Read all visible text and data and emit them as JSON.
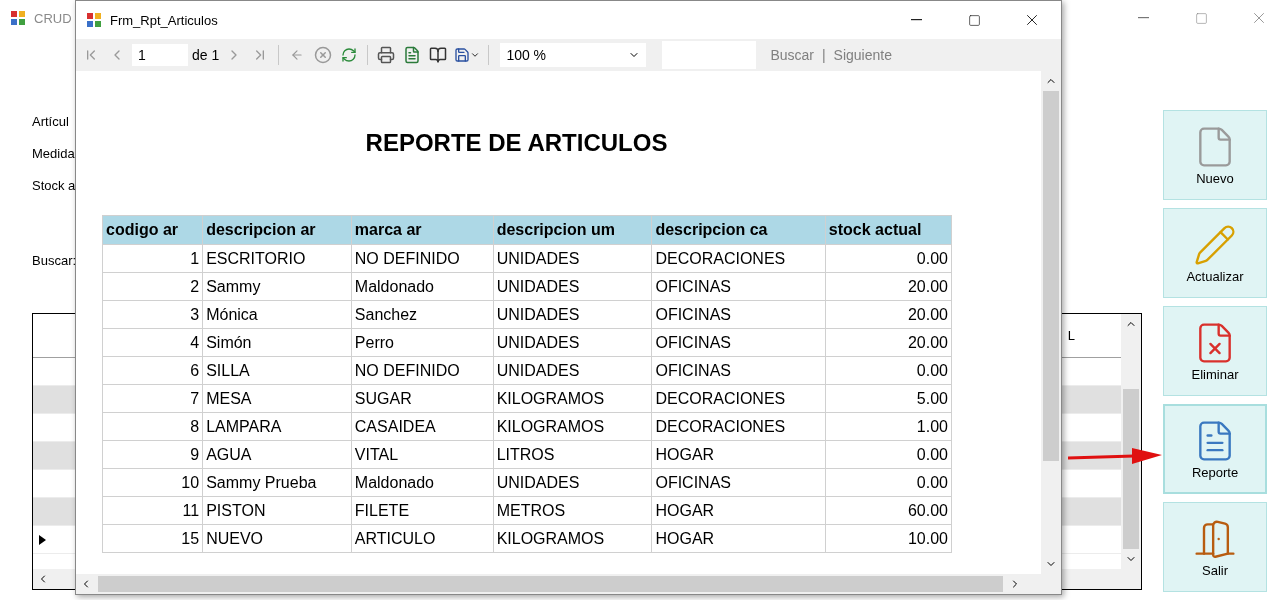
{
  "main_window": {
    "title": "CRUD",
    "labels": [
      "Artícul",
      "Medida",
      "Stock a",
      "Buscar:"
    ],
    "grid": {
      "header_text": "L"
    },
    "buttons": [
      {
        "label": "Nuevo",
        "kind": "new",
        "focused": false
      },
      {
        "label": "Actualizar",
        "kind": "edit",
        "focused": false
      },
      {
        "label": "Eliminar",
        "kind": "delete",
        "focused": false
      },
      {
        "label": "Reporte",
        "kind": "report",
        "focused": true
      },
      {
        "label": "Salir",
        "kind": "exit",
        "focused": false
      }
    ]
  },
  "report_window": {
    "title": "Frm_Rpt_Articulos",
    "toolbar": {
      "page": "1",
      "of_label": "de",
      "total": "1",
      "zoom": "100 %",
      "find_label": "Buscar",
      "separator": "|",
      "next_label": "Siguiente",
      "find_disabled": true
    },
    "report": {
      "title": "REPORTE DE ARTICULOS",
      "columns": [
        {
          "label": "codigo ar",
          "kind": "number"
        },
        {
          "label": "descripcion ar",
          "kind": "text"
        },
        {
          "label": "marca ar",
          "kind": "text"
        },
        {
          "label": "descripcion um",
          "kind": "text"
        },
        {
          "label": "descripcion ca",
          "kind": "text"
        },
        {
          "label": "stock actual",
          "kind": "number"
        }
      ],
      "rows": [
        [
          "1",
          "ESCRITORIO",
          "NO DEFINIDO",
          "UNIDADES",
          "DECORACIONES",
          "0.00"
        ],
        [
          "2",
          "Sammy",
          "Maldonado",
          "UNIDADES",
          "OFICINAS",
          "20.00"
        ],
        [
          "3",
          "Mónica",
          "Sanchez",
          "UNIDADES",
          "OFICINAS",
          "20.00"
        ],
        [
          "4",
          "Simón",
          "Perro",
          "UNIDADES",
          "OFICINAS",
          "20.00"
        ],
        [
          "6",
          "SILLA",
          "NO DEFINIDO",
          "UNIDADES",
          "OFICINAS",
          "0.00"
        ],
        [
          "7",
          "MESA",
          "SUGAR",
          "KILOGRAMOS",
          "DECORACIONES",
          "5.00"
        ],
        [
          "8",
          "LAMPARA",
          "CASAIDEA",
          "KILOGRAMOS",
          "DECORACIONES",
          "1.00"
        ],
        [
          "9",
          "AGUA",
          "VITAL",
          "LITROS",
          "HOGAR",
          "0.00"
        ],
        [
          "10",
          "Sammy Prueba",
          "Maldonado",
          "UNIDADES",
          "OFICINAS",
          "0.00"
        ],
        [
          "11",
          "PISTON",
          "FILETE",
          "METROS",
          "HOGAR",
          "60.00"
        ],
        [
          "15",
          "NUEVO",
          "ARTICULO",
          "KILOGRAMOS",
          "HOGAR",
          "10.00"
        ]
      ]
    }
  }
}
